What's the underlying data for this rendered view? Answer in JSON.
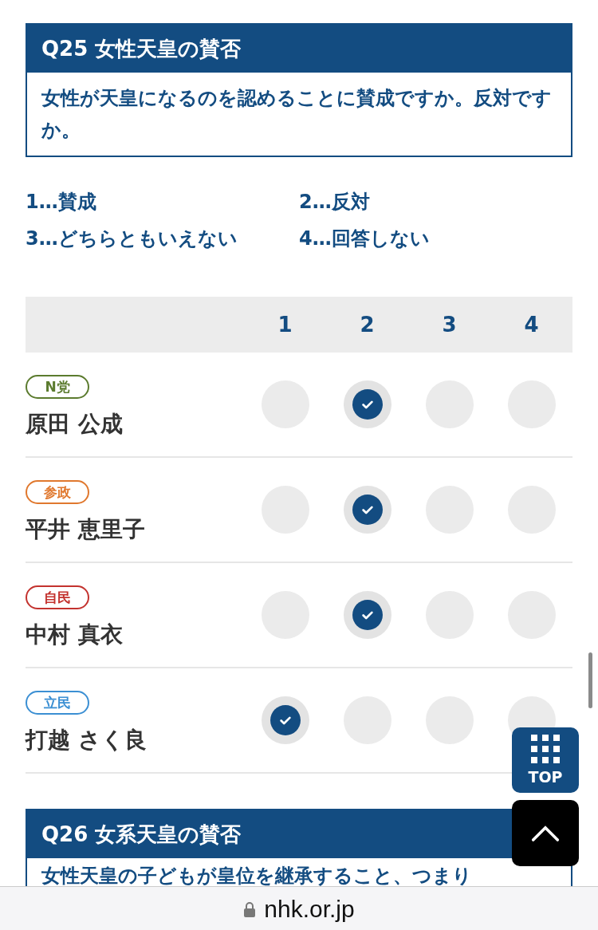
{
  "question": {
    "title": "Q25 女性天皇の賛否",
    "text": "女性が天皇になるのを認めることに賛成ですか。反対ですか。"
  },
  "options": [
    "1…賛成",
    "2…反対",
    "3…どちらともいえない",
    "4…回答しない"
  ],
  "table": {
    "columns": [
      "1",
      "2",
      "3",
      "4"
    ],
    "rows": [
      {
        "party": "N党",
        "color": "#5b7b2e",
        "name": "原田 公成",
        "answers": [
          {
            "selected": false
          },
          {
            "selected": true
          },
          {
            "selected": false
          },
          {
            "selected": false
          }
        ]
      },
      {
        "party": "参政",
        "color": "#e0782e",
        "name": "平井 恵里子",
        "answers": [
          {
            "selected": false
          },
          {
            "selected": true
          },
          {
            "selected": false
          },
          {
            "selected": false
          }
        ]
      },
      {
        "party": "自民",
        "color": "#c3322e",
        "name": "中村 真衣",
        "answers": [
          {
            "selected": false
          },
          {
            "selected": true
          },
          {
            "selected": false
          },
          {
            "selected": false
          }
        ]
      },
      {
        "party": "立民",
        "color": "#3b8fd3",
        "name": "打越 さく良",
        "answers": [
          {
            "selected": true
          },
          {
            "selected": false
          },
          {
            "selected": false
          },
          {
            "selected": false
          }
        ]
      }
    ]
  },
  "next_question": {
    "title": "Q26 女系天皇の賛否",
    "text": "女性天皇の子どもが皇位を継承すること、つまり"
  },
  "top_button": {
    "label": "TOP"
  },
  "address_bar": {
    "url": "nhk.or.jp"
  }
}
